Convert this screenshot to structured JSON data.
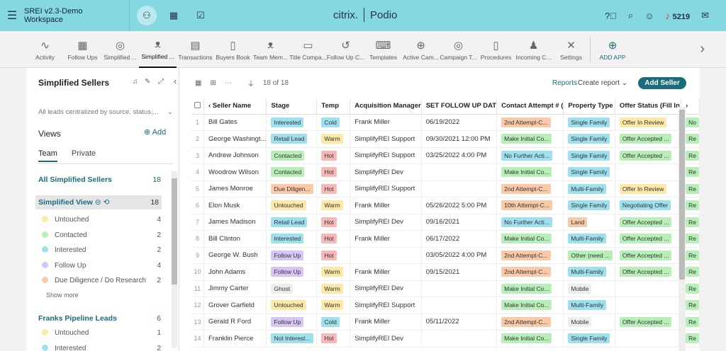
{
  "topbar": {
    "workspace": "SREI v2.3-Demo Workspace",
    "logo_left": "citrix.",
    "logo_right": "Podio",
    "notification_count": "5219"
  },
  "apps": [
    {
      "label": "Activity",
      "icon": "∿"
    },
    {
      "label": "Follow Ups",
      "icon": "▦"
    },
    {
      "label": "Simplified ...",
      "icon": "◎"
    },
    {
      "label": "Simplified ...",
      "icon": "ᴥ",
      "selected": true
    },
    {
      "label": "Transactions",
      "icon": "▤"
    },
    {
      "label": "Buyers Book",
      "icon": "▯"
    },
    {
      "label": "Team Mem...",
      "icon": "ᴥ"
    },
    {
      "label": "Title Compa...",
      "icon": "▭"
    },
    {
      "label": "Follow Up C...",
      "icon": "↺"
    },
    {
      "label": "Templates",
      "icon": "⌨"
    },
    {
      "label": "Active Cam...",
      "icon": "⊕"
    },
    {
      "label": "Campaign T...",
      "icon": "◎"
    },
    {
      "label": "Procedures",
      "icon": "▯"
    },
    {
      "label": "Incoming C...",
      "icon": "♟"
    },
    {
      "label": "Settings",
      "icon": "✕"
    }
  ],
  "add_app": {
    "label": "ADD APP",
    "icon": "⊕"
  },
  "sidebar": {
    "title": "Simplified Sellers",
    "description": "All leads centralized by source, status,...",
    "views_label": "Views",
    "add_label": "Add",
    "tab_team": "Team",
    "tab_private": "Private",
    "all_label": "All Simplified Sellers",
    "all_count": "18",
    "view_label": "Simplified View",
    "view_count": "18",
    "stages": [
      {
        "label": "Untouched",
        "count": "4",
        "color": "#fce8a8"
      },
      {
        "label": "Contacted",
        "count": "2",
        "color": "#b8efb8"
      },
      {
        "label": "Interested",
        "count": "2",
        "color": "#9fe0ee"
      },
      {
        "label": "Follow Up",
        "count": "4",
        "color": "#d7c6f5"
      },
      {
        "label": "Due Diligence / Do Research",
        "count": "2",
        "color": "#f9c9a8"
      }
    ],
    "show_more": "Show more",
    "franks_label": "Franks Pipeline Leads",
    "franks_count": "6",
    "franks_stages": [
      {
        "label": "Untouched",
        "count": "1",
        "color": "#fce8a8"
      },
      {
        "label": "Interested",
        "count": "2",
        "color": "#9fe0ee"
      }
    ]
  },
  "main": {
    "record_count": "18 of 18",
    "reports": "Reports",
    "create_report": "Create report",
    "add_button": "Add Seller"
  },
  "colors": {
    "Interested": "#9fe0ee",
    "Retail Lead": "#9fe0ee",
    "Contacted": "#b8efb8",
    "Due Diligen...": "#f9c9a8",
    "Untouched": "#fce8a8",
    "Follow Up": "#d7c6f5",
    "Ghost": "#eeeeee",
    "Not Interest...": "#9fe0ee",
    "Cold": "#9fe0ee",
    "Warm": "#fce8a8",
    "Hot": "#f7b8b8",
    "contact_orange": "#f9c9a8",
    "contact_blue": "#9fe0ee",
    "contact_green": "#b8efb8",
    "prop_blue": "#9fe0ee",
    "prop_orange": "#f9c9a8",
    "prop_grey": "#eeeeee",
    "prop_green": "#b8efb8",
    "offer_yellow": "#fce8a8",
    "offer_green": "#b8efb8",
    "offer_blue": "#9fe0ee"
  },
  "table": {
    "columns": [
      "Seller Name",
      "Stage",
      "Temp",
      "Acquisition Manager",
      "SET FOLLOW UP DAT",
      "Contact Attempt # (",
      "Property Type",
      "Offer Status (Fill In",
      ""
    ],
    "rows": [
      {
        "n": "1",
        "name": "Bill Gates",
        "stage": "Interested",
        "temp": "Cold",
        "mgr": "Frank Miller",
        "date": "06/19/2022",
        "contact": "2nd Attempt-C...",
        "cc": "contact_orange",
        "prop": "Single Family",
        "pc": "prop_blue",
        "offer": "Offer In Review",
        "oc": "offer_yellow",
        "extra": "No"
      },
      {
        "n": "2",
        "name": "George Washingt...",
        "stage": "Retail Lead",
        "temp": "Warm",
        "mgr": "SimplifyREI Support",
        "date": "09/30/2021 12:00 PM",
        "contact": "Make Initial Co...",
        "cc": "contact_green",
        "prop": "Single Family",
        "pc": "prop_blue",
        "offer": "Offer Accepted ...",
        "oc": "offer_green",
        "extra": "Re"
      },
      {
        "n": "3",
        "name": "Andrew Johnson",
        "stage": "Contacted",
        "temp": "Hot",
        "mgr": "SimplifyREI Support",
        "date": "03/25/2022 4:00 PM",
        "contact": "No Further Acti...",
        "cc": "contact_blue",
        "prop": "Single Family",
        "pc": "prop_blue",
        "offer": "Offer Accepted ...",
        "oc": "offer_green",
        "extra": "Re"
      },
      {
        "n": "4",
        "name": "Woodrow Wilson",
        "stage": "Contacted",
        "temp": "Hot",
        "mgr": "SimplifyREI Dev",
        "date": "",
        "contact": "Make Initial Co...",
        "cc": "contact_green",
        "prop": "Single Family",
        "pc": "prop_blue",
        "offer": "",
        "oc": "",
        "extra": "Re"
      },
      {
        "n": "5",
        "name": "James Monroe",
        "stage": "Due Diligen...",
        "temp": "Hot",
        "mgr": "SimplifyREI Support",
        "date": "",
        "contact": "2nd Attempt-C...",
        "cc": "contact_orange",
        "prop": "Multi-Family",
        "pc": "prop_blue",
        "offer": "Offer In Review",
        "oc": "offer_yellow",
        "extra": "Re"
      },
      {
        "n": "6",
        "name": "Elon Musk",
        "stage": "Untouched",
        "temp": "Warm",
        "mgr": "Frank Miller",
        "date": "05/26/2022 5:00 PM",
        "contact": "10th Attempt-C...",
        "cc": "contact_orange",
        "prop": "Single Family",
        "pc": "prop_blue",
        "offer": "Negotiating Offer",
        "oc": "offer_blue",
        "extra": "Re"
      },
      {
        "n": "7",
        "name": "James Madison",
        "stage": "Retail Lead",
        "temp": "Hot",
        "mgr": "SimplifyREI Dev",
        "date": "09/16/2021",
        "contact": "No Further Acti...",
        "cc": "contact_blue",
        "prop": "Land",
        "pc": "prop_orange",
        "offer": "Offer Accepted ...",
        "oc": "offer_green",
        "extra": "Re"
      },
      {
        "n": "8",
        "name": "Bill Clinton",
        "stage": "Interested",
        "temp": "Hot",
        "mgr": "Frank Miller",
        "date": "06/17/2022",
        "contact": "Make Initial Co...",
        "cc": "contact_green",
        "prop": "Multi-Family",
        "pc": "prop_blue",
        "offer": "Offer Accepted ...",
        "oc": "offer_green",
        "extra": "Re"
      },
      {
        "n": "9",
        "name": "George W. Bush",
        "stage": "Follow Up",
        "temp": "Hot",
        "mgr": "",
        "date": "03/05/2022 4:00 PM",
        "contact": "2nd Attempt-C...",
        "cc": "contact_orange",
        "prop": "Other (need ...",
        "pc": "prop_green",
        "offer": "Offer Accepted ...",
        "oc": "offer_green",
        "extra": "Re"
      },
      {
        "n": "10",
        "name": "John Adams",
        "stage": "Follow Up",
        "temp": "Warm",
        "mgr": "Frank Miller",
        "date": "09/15/2021",
        "contact": "2nd Attempt-C...",
        "cc": "contact_orange",
        "prop": "Multi-Family",
        "pc": "prop_blue",
        "offer": "Offer Accepted ...",
        "oc": "offer_green",
        "extra": "Re"
      },
      {
        "n": "11",
        "name": "Jimmy Carter",
        "stage": "Ghost",
        "temp": "Warm",
        "mgr": "SimplifyREI Dev",
        "date": "",
        "contact": "Make Initial Co...",
        "cc": "contact_green",
        "prop": "Mobile",
        "pc": "prop_grey",
        "offer": "",
        "oc": "",
        "extra": "Re"
      },
      {
        "n": "12",
        "name": "Grover Garfield",
        "stage": "Untouched",
        "temp": "Warm",
        "mgr": "SimplifyREI Support",
        "date": "",
        "contact": "Make Initial Co...",
        "cc": "contact_green",
        "prop": "Multi-Family",
        "pc": "prop_blue",
        "offer": "",
        "oc": "",
        "extra": "Re"
      },
      {
        "n": "13",
        "name": "Gerald R Ford",
        "stage": "Follow Up",
        "temp": "Cold",
        "mgr": "Frank Miller",
        "date": "05/11/2022",
        "contact": "2nd Attempt-C...",
        "cc": "contact_orange",
        "prop": "Mobile",
        "pc": "prop_grey",
        "offer": "Offer Accepted ...",
        "oc": "offer_green",
        "extra": "Re"
      },
      {
        "n": "14",
        "name": "Franklin Pierce",
        "stage": "Not Interest...",
        "temp": "Hot",
        "mgr": "SimplifyREI Dev",
        "date": "",
        "contact": "Make Initial Co...",
        "cc": "contact_green",
        "prop": "Single Family",
        "pc": "prop_blue",
        "offer": "",
        "oc": "",
        "extra": "Re"
      }
    ]
  }
}
